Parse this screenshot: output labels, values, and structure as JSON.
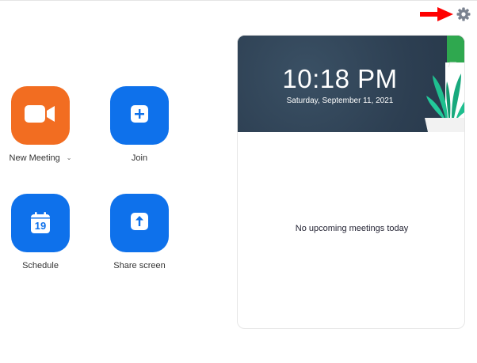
{
  "window": {
    "settings_icon": "gear-icon",
    "annotation_icon": "red-arrow-icon",
    "annotation_color": "#ff0000"
  },
  "actions": [
    {
      "label": "New Meeting",
      "icon": "video-camera-icon",
      "color": "#f26d21",
      "has_dropdown": true,
      "dropdown_icon": "chevron-down-icon"
    },
    {
      "label": "Join",
      "icon": "plus-icon",
      "color": "#0e71eb"
    },
    {
      "label": "Schedule",
      "icon": "calendar-icon",
      "color": "#0e71eb",
      "calendar_day": "19"
    },
    {
      "label": "Share screen",
      "icon": "arrow-up-icon",
      "color": "#0e71eb"
    }
  ],
  "meetings_panel": {
    "time": "10:18 PM",
    "date": "Saturday, September 11, 2021",
    "empty_message": "No upcoming meetings today",
    "header_color": "#2f4255"
  }
}
